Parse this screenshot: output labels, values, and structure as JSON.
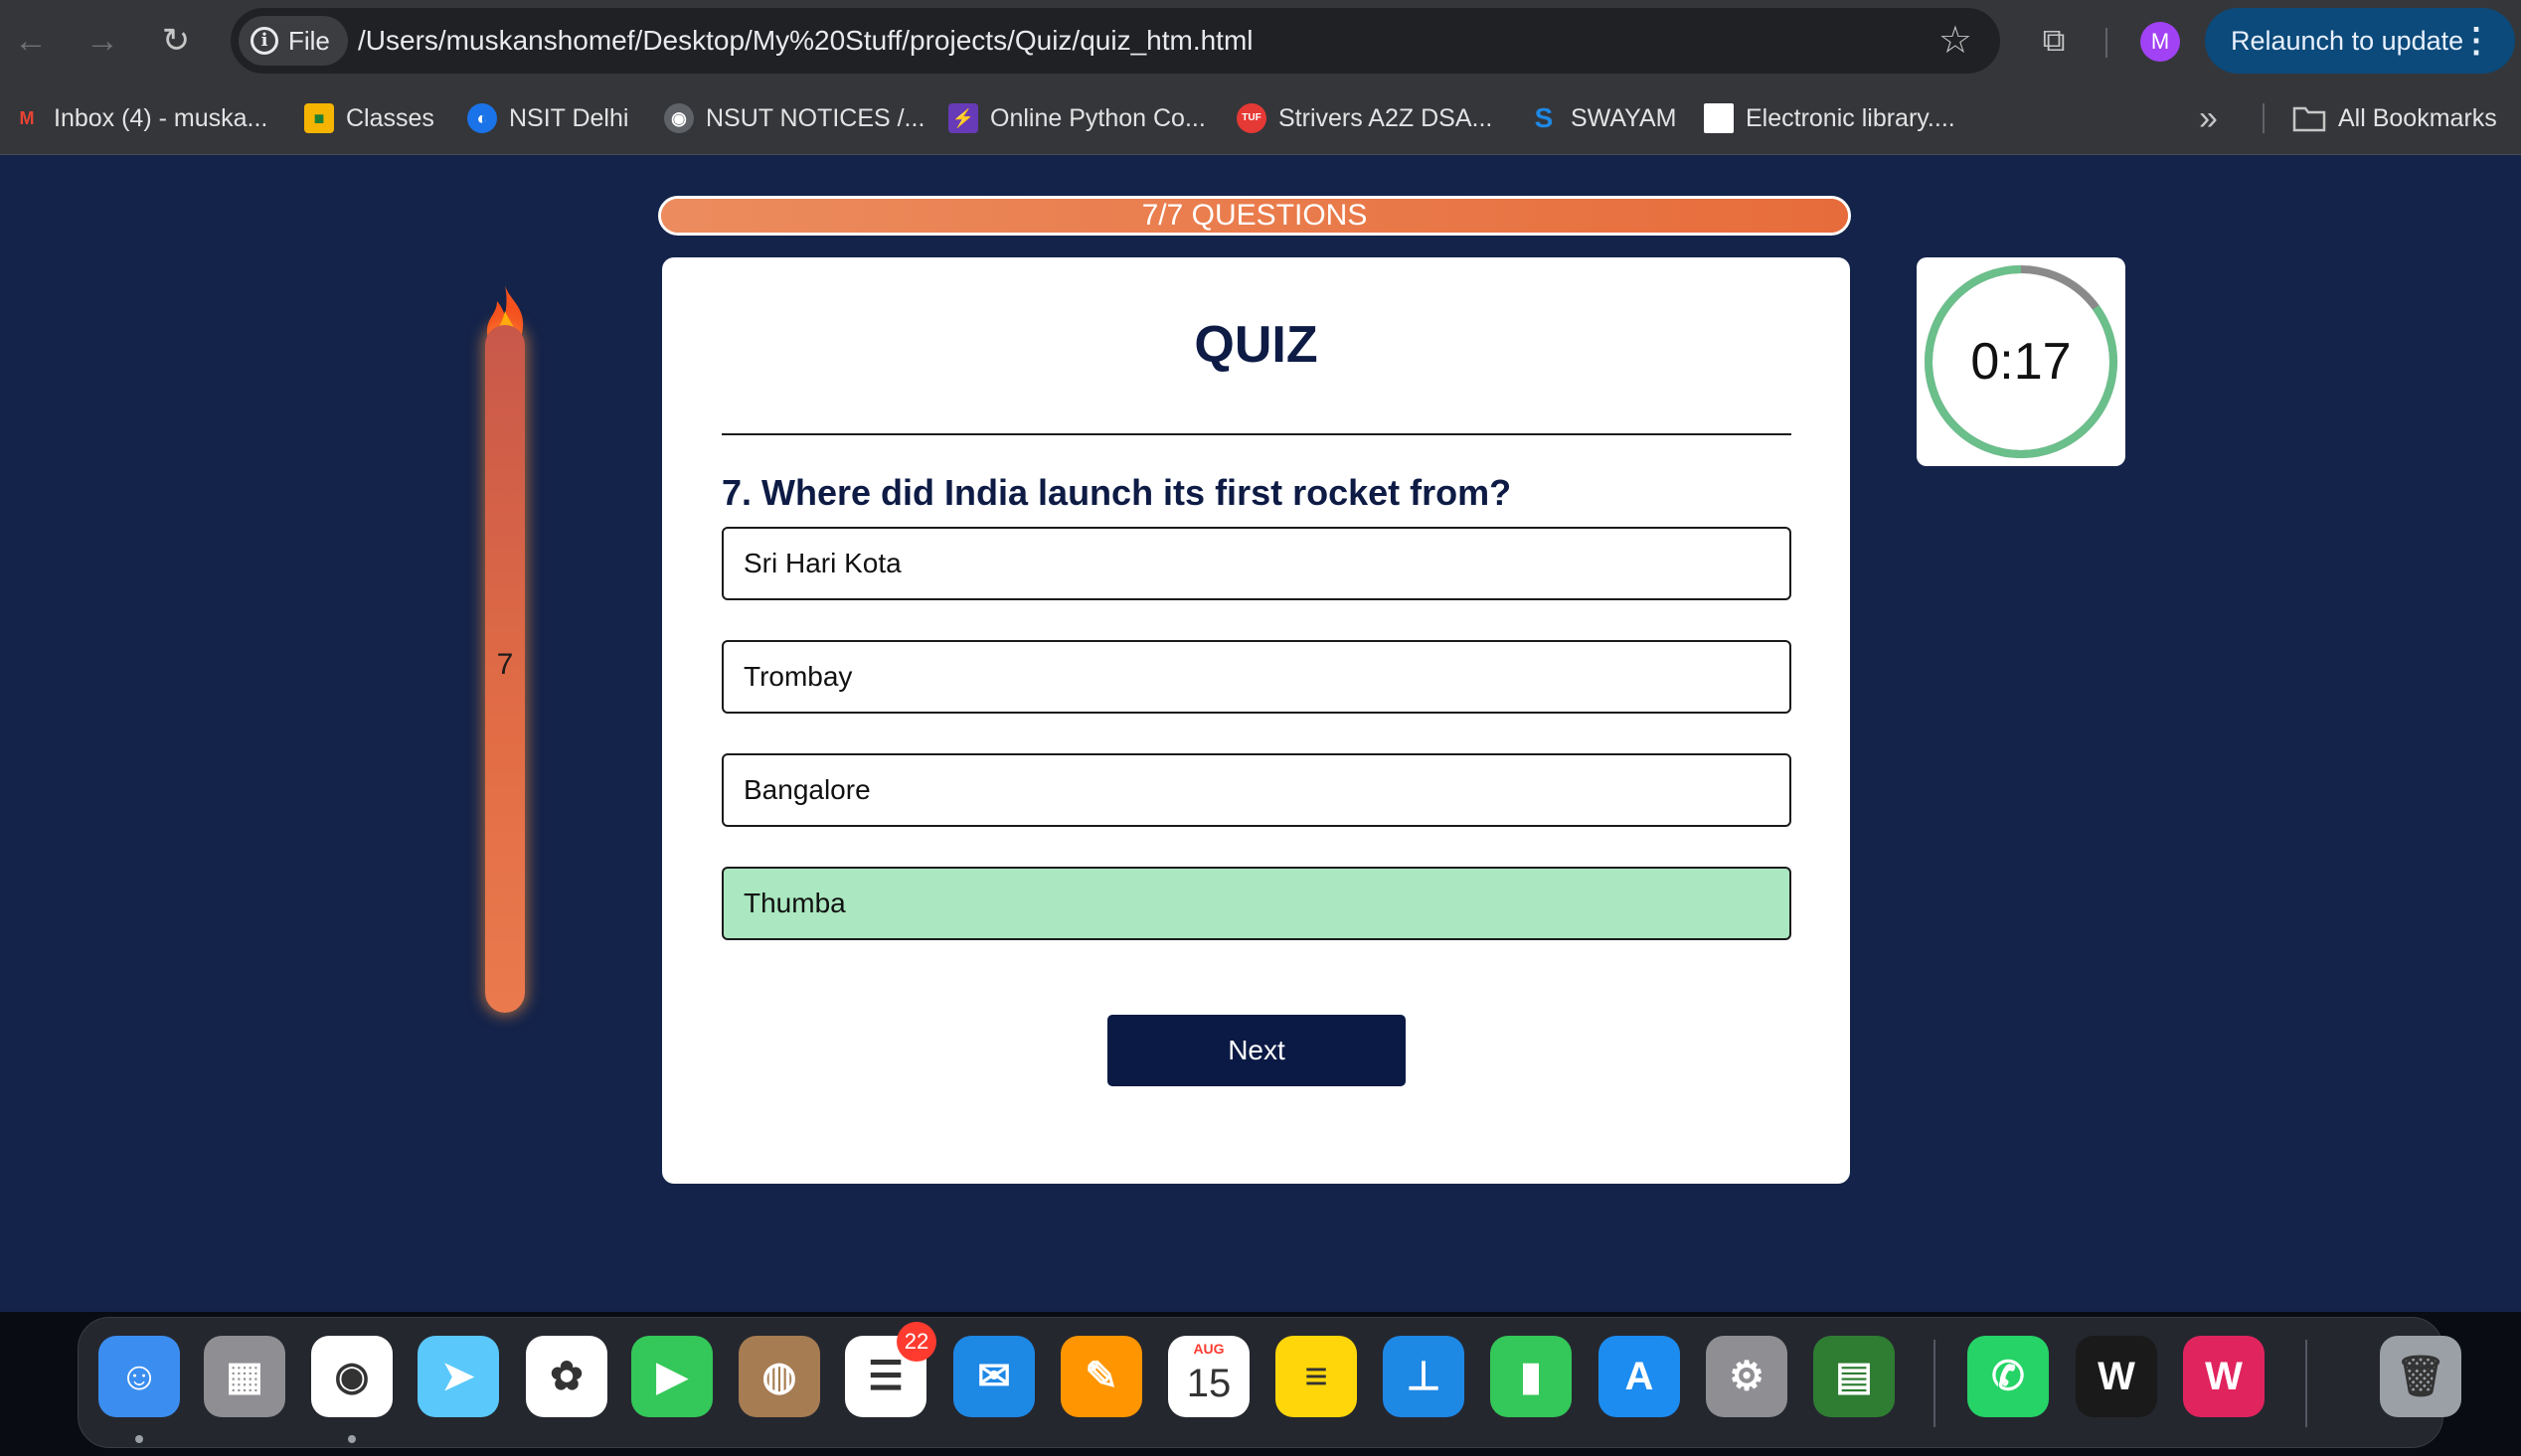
{
  "browser": {
    "url": "/Users/muskanshomef/Desktop/My%20Stuff/projects/Quiz/quiz_htm.html",
    "scheme_chip": "File",
    "profile_initial": "M",
    "relaunch_label": "Relaunch to update",
    "bookmarks": [
      {
        "label": "Inbox (4) - muska...",
        "icon": "gmail-icon",
        "color": "#ea4335"
      },
      {
        "label": "Classes",
        "icon": "classroom-icon",
        "color": "#f4b400"
      },
      {
        "label": "NSIT Delhi",
        "icon": "nsit-icon",
        "color": "#1a73e8"
      },
      {
        "label": "NSUT NOTICES /...",
        "icon": "globe-icon",
        "color": "#9aa0a6"
      },
      {
        "label": "Online Python Co...",
        "icon": "bolt-icon",
        "color": "#673ab7"
      },
      {
        "label": "Strivers A2Z DSA...",
        "icon": "tuf-icon",
        "color": "#e53935"
      },
      {
        "label": "SWAYAM",
        "icon": "swayam-icon",
        "color": "#1565c0"
      },
      {
        "label": "Electronic library....",
        "icon": "page-icon",
        "color": "#ffffff"
      }
    ],
    "all_bookmarks_label": "All Bookmarks"
  },
  "quiz": {
    "progress_label": "7/7 QUESTIONS",
    "progress_fraction": 1.0,
    "streak_count": "7",
    "title": "QUIZ",
    "question": "7. Where did India launch its first rocket from?",
    "options": [
      {
        "label": "Sri Hari Kota",
        "state": "default"
      },
      {
        "label": "Trombay",
        "state": "default"
      },
      {
        "label": "Bangalore",
        "state": "default"
      },
      {
        "label": "Thumba",
        "state": "correct"
      }
    ],
    "next_label": "Next",
    "timer": {
      "text": "0:17",
      "remaining_fraction": 0.85,
      "ring_color": "#6abf8a",
      "track_color": "#8a8a8a"
    }
  },
  "colors": {
    "page_bg": "#14234a",
    "accent_orange": "#e76c3b",
    "navy": "#0d1b45",
    "correct_green": "#abe7c0"
  },
  "dock": {
    "apps": [
      {
        "name": "finder-icon",
        "glyph": "☺",
        "color": "#3b8ef0",
        "running": true
      },
      {
        "name": "launchpad-icon",
        "glyph": "▦",
        "color": "#8e8e93",
        "running": false
      },
      {
        "name": "chrome-icon",
        "glyph": "◉",
        "color": "#ffffff",
        "running": true
      },
      {
        "name": "maps-icon",
        "glyph": "➤",
        "color": "#5ac8fa",
        "running": false
      },
      {
        "name": "photos-icon",
        "glyph": "✿",
        "color": "#ffffff",
        "running": false
      },
      {
        "name": "facetime-icon",
        "glyph": "▶",
        "color": "#34c759",
        "running": false
      },
      {
        "name": "contacts-icon",
        "glyph": "◍",
        "color": "#a67c52",
        "running": false
      },
      {
        "name": "reminders-icon",
        "glyph": "☰",
        "color": "#ffffff",
        "running": false,
        "badge": "22"
      },
      {
        "name": "mail-icon",
        "glyph": "✉",
        "color": "#1e88e5",
        "running": false
      },
      {
        "name": "pages-icon",
        "glyph": "✎",
        "color": "#ff9500",
        "running": false
      },
      {
        "name": "calendar-icon",
        "glyph": "15",
        "color": "#ffffff",
        "running": false
      },
      {
        "name": "notes-icon",
        "glyph": "≡",
        "color": "#ffd60a",
        "running": false
      },
      {
        "name": "keynote-icon",
        "glyph": "⊥",
        "color": "#1e88e5",
        "running": false
      },
      {
        "name": "numbers-icon",
        "glyph": "▮",
        "color": "#34c759",
        "running": false
      },
      {
        "name": "app-store-icon",
        "glyph": "A",
        "color": "#1c8cf0",
        "running": false
      },
      {
        "name": "system-settings-icon",
        "glyph": "⚙",
        "color": "#8e8e93",
        "running": false
      },
      {
        "name": "circuit-board-icon",
        "glyph": "▤",
        "color": "#2e7d32",
        "running": false
      },
      {
        "name": "whatsapp-icon",
        "glyph": "✆",
        "color": "#25d366",
        "running": false
      },
      {
        "name": "webex-icon",
        "glyph": "W",
        "color": "#1a1a1a",
        "running": false
      },
      {
        "name": "wps-office-icon",
        "glyph": "W",
        "color": "#e0245e",
        "running": false
      },
      {
        "name": "trash-icon",
        "glyph": "🗑",
        "color": "#9aa0a6",
        "running": false
      }
    ],
    "calendar_month": "AUG"
  }
}
